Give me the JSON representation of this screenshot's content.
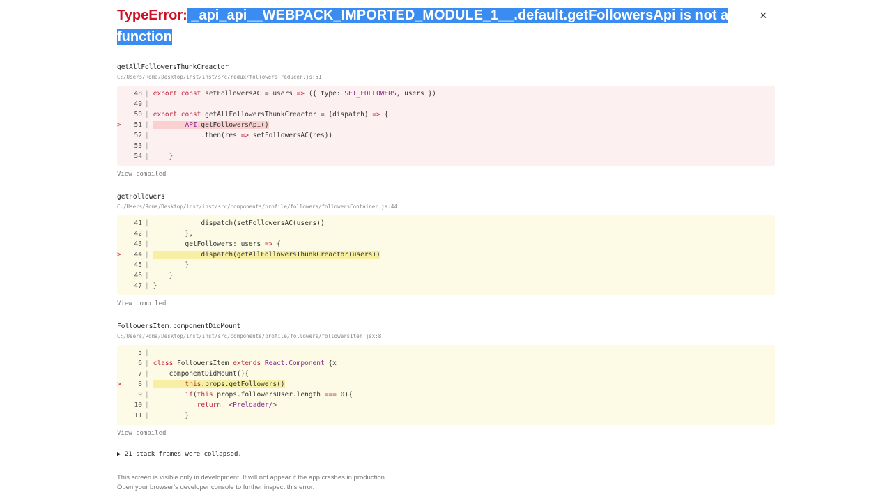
{
  "error": {
    "type": "TypeError:",
    "message": " _api_api__WEBPACK_IMPORTED_MODULE_1__.default.getFollowersApi is not a function",
    "close_label": "×"
  },
  "frames": [
    {
      "name": "getAllFollowersThunkCreactor",
      "file": "C:/Users/Roma/Desktop/inst/inst/src/redux/followers-reducer.js:51",
      "theme": "red",
      "view_compiled": "View compiled",
      "lines": [
        {
          "n": "48",
          "hl": false,
          "segs": [
            [
              "k",
              "export const "
            ],
            [
              "",
              "setFollowersAC = users "
            ],
            [
              "o",
              "=>"
            ],
            [
              "",
              " ({ type: "
            ],
            [
              "p",
              "SET_FOLLOWERS"
            ],
            [
              "",
              ", users })"
            ]
          ]
        },
        {
          "n": "49",
          "hl": false,
          "segs": []
        },
        {
          "n": "50",
          "hl": false,
          "segs": [
            [
              "k",
              "export const "
            ],
            [
              "",
              "getAllFollowersThunkCreactor = (dispatch) "
            ],
            [
              "o",
              "=>"
            ],
            [
              "",
              " {"
            ]
          ]
        },
        {
          "n": "51",
          "hl": true,
          "segs": [
            [
              "",
              "        "
            ],
            [
              "p",
              "API"
            ],
            [
              "",
              ".getFollowersApi()"
            ]
          ]
        },
        {
          "n": "52",
          "hl": false,
          "segs": [
            [
              "",
              "            .then(res "
            ],
            [
              "o",
              "=>"
            ],
            [
              "",
              " setFollowersAC(res))"
            ]
          ]
        },
        {
          "n": "53",
          "hl": false,
          "segs": []
        },
        {
          "n": "54",
          "hl": false,
          "segs": [
            [
              "",
              "    }"
            ]
          ]
        }
      ]
    },
    {
      "name": "getFollowers",
      "file": "C:/Users/Roma/Desktop/inst/inst/src/components/profile/followers/followersContainer.js:44",
      "theme": "yellow",
      "view_compiled": "View compiled",
      "lines": [
        {
          "n": "41",
          "hl": false,
          "segs": [
            [
              "",
              "            dispatch(setFollowersAC(users))"
            ]
          ]
        },
        {
          "n": "42",
          "hl": false,
          "segs": [
            [
              "",
              "        },"
            ]
          ]
        },
        {
          "n": "43",
          "hl": false,
          "segs": [
            [
              "",
              "        getFollowers: users "
            ],
            [
              "o",
              "=>"
            ],
            [
              "",
              " {"
            ]
          ]
        },
        {
          "n": "44",
          "hl": true,
          "segs": [
            [
              "",
              "            dispatch(getAllFollowersThunkCreactor(users))"
            ]
          ]
        },
        {
          "n": "45",
          "hl": false,
          "segs": [
            [
              "",
              "        }"
            ]
          ]
        },
        {
          "n": "46",
          "hl": false,
          "segs": [
            [
              "",
              "    }"
            ]
          ]
        },
        {
          "n": "47",
          "hl": false,
          "segs": [
            [
              "",
              "}"
            ]
          ]
        }
      ]
    },
    {
      "name": "FollowersItem.componentDidMount",
      "file": "C:/Users/Roma/Desktop/inst/inst/src/components/profile/followers/followersItem.jsx:8",
      "theme": "yellow",
      "view_compiled": "View compiled",
      "lines": [
        {
          "n": "5",
          "hl": false,
          "segs": []
        },
        {
          "n": "6",
          "hl": false,
          "segs": [
            [
              "k",
              "class "
            ],
            [
              "",
              "FollowersItem "
            ],
            [
              "k",
              "extends "
            ],
            [
              "p",
              "React.Component"
            ],
            [
              "",
              " {x"
            ]
          ]
        },
        {
          "n": "7",
          "hl": false,
          "segs": [
            [
              "",
              "    componentDidMount(){"
            ]
          ]
        },
        {
          "n": "8",
          "hl": true,
          "segs": [
            [
              "",
              "        "
            ],
            [
              "k",
              "this"
            ],
            [
              "",
              ".props.getFollowers()"
            ]
          ]
        },
        {
          "n": "9",
          "hl": false,
          "segs": [
            [
              "",
              "        "
            ],
            [
              "k",
              "if"
            ],
            [
              "",
              "("
            ],
            [
              "k",
              "this"
            ],
            [
              "",
              ".props.followersUser.length "
            ],
            [
              "o",
              "==="
            ],
            [
              "",
              " 0){"
            ]
          ]
        },
        {
          "n": "10",
          "hl": false,
          "segs": [
            [
              "",
              "           "
            ],
            [
              "k",
              "return"
            ],
            [
              "",
              "  "
            ],
            [
              "p",
              "<Preloader/>"
            ]
          ]
        },
        {
          "n": "11",
          "hl": false,
          "segs": [
            [
              "",
              "        }"
            ]
          ]
        }
      ]
    }
  ],
  "collapsed": "▶ 21 stack frames were collapsed.",
  "footer": [
    "This screen is visible only in development. It will not appear if the app crashes in production.",
    "Open your browser’s developer console to further inspect this error."
  ]
}
